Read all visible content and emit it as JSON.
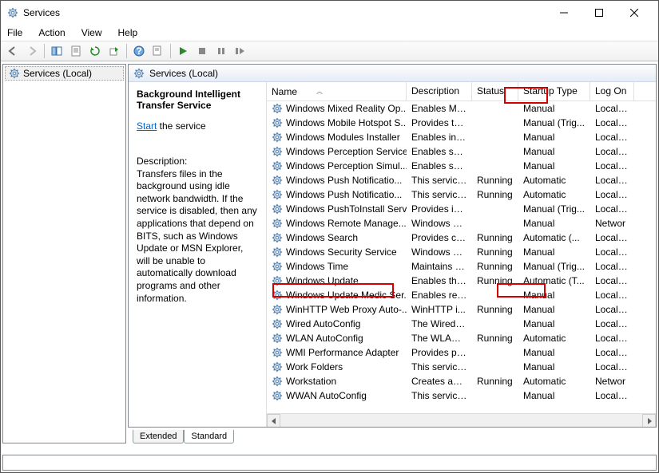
{
  "title": "Services",
  "menu": {
    "file": "File",
    "action": "Action",
    "view": "View",
    "help": "Help"
  },
  "left": {
    "label": "Services (Local)"
  },
  "pane": {
    "header": "Services (Local)",
    "selected_name": "Background Intelligent Transfer Service",
    "start_link": "Start",
    "start_tail": " the service",
    "desc_h": "Description:",
    "desc_body": "Transfers files in the background using idle network bandwidth. If the service is disabled, then any applications that depend on BITS, such as Windows Update or MSN Explorer, will be unable to automatically download programs and other information."
  },
  "cols": {
    "name": "Name",
    "description": "Description",
    "status": "Status",
    "startup": "Startup Type",
    "logon": "Log On"
  },
  "rows": [
    {
      "name": "Windows Mixed Reality Op...",
      "desc": "Enables Mix...",
      "status": "",
      "startup": "Manual",
      "logon": "Local Sy"
    },
    {
      "name": "Windows Mobile Hotspot S...",
      "desc": "Provides th...",
      "status": "",
      "startup": "Manual (Trig...",
      "logon": "Local Sy"
    },
    {
      "name": "Windows Modules Installer",
      "desc": "Enables inst...",
      "status": "",
      "startup": "Manual",
      "logon": "Local Sy"
    },
    {
      "name": "Windows Perception Service",
      "desc": "Enables spa...",
      "status": "",
      "startup": "Manual",
      "logon": "Local Sy"
    },
    {
      "name": "Windows Perception Simul...",
      "desc": "Enables spa...",
      "status": "",
      "startup": "Manual",
      "logon": "Local Sy"
    },
    {
      "name": "Windows Push Notificatio...",
      "desc": "This service ...",
      "status": "Running",
      "startup": "Automatic",
      "logon": "Local Sy"
    },
    {
      "name": "Windows Push Notificatio...",
      "desc": "This service ...",
      "status": "Running",
      "startup": "Automatic",
      "logon": "Local Sy"
    },
    {
      "name": "Windows PushToInstall Serv...",
      "desc": "Provides inf...",
      "status": "",
      "startup": "Manual (Trig...",
      "logon": "Local Sy"
    },
    {
      "name": "Windows Remote Manage...",
      "desc": "Windows R...",
      "status": "",
      "startup": "Manual",
      "logon": "Networ"
    },
    {
      "name": "Windows Search",
      "desc": "Provides co...",
      "status": "Running",
      "startup": "Automatic (...",
      "logon": "Local Sy"
    },
    {
      "name": "Windows Security Service",
      "desc": "Windows Se...",
      "status": "Running",
      "startup": "Manual",
      "logon": "Local Sy"
    },
    {
      "name": "Windows Time",
      "desc": "Maintains d...",
      "status": "Running",
      "startup": "Manual (Trig...",
      "logon": "Local Se"
    },
    {
      "name": "Windows Update",
      "desc": "Enables the ...",
      "status": "Running",
      "startup": "Automatic (T...",
      "logon": "Local Sy"
    },
    {
      "name": "Windows Update Medic Ser...",
      "desc": "Enables rem...",
      "status": "",
      "startup": "Manual",
      "logon": "Local Sy"
    },
    {
      "name": "WinHTTP Web Proxy Auto-...",
      "desc": "WinHTTP i...",
      "status": "Running",
      "startup": "Manual",
      "logon": "Local Se"
    },
    {
      "name": "Wired AutoConfig",
      "desc": "The Wired A...",
      "status": "",
      "startup": "Manual",
      "logon": "Local Sy"
    },
    {
      "name": "WLAN AutoConfig",
      "desc": "The WLANS...",
      "status": "Running",
      "startup": "Automatic",
      "logon": "Local Sy"
    },
    {
      "name": "WMI Performance Adapter",
      "desc": "Provides pe...",
      "status": "",
      "startup": "Manual",
      "logon": "Local Sy"
    },
    {
      "name": "Work Folders",
      "desc": "This service ...",
      "status": "",
      "startup": "Manual",
      "logon": "Local Se"
    },
    {
      "name": "Workstation",
      "desc": "Creates and...",
      "status": "Running",
      "startup": "Automatic",
      "logon": "Networ"
    },
    {
      "name": "WWAN AutoConfig",
      "desc": "This service ...",
      "status": "",
      "startup": "Manual",
      "logon": "Local Sy"
    }
  ],
  "tabs": {
    "extended": "Extended",
    "standard": "Standard"
  }
}
